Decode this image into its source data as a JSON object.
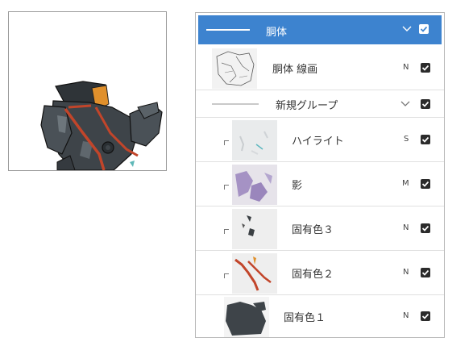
{
  "panel": {
    "group_top": {
      "name": "胴体"
    },
    "layers": [
      {
        "name": "胴体 線画",
        "blend": "N"
      },
      {
        "name": "新規グループ"
      },
      {
        "name": "ハイライト",
        "blend": "S"
      },
      {
        "name": "影",
        "blend": "M"
      },
      {
        "name": "固有色３",
        "blend": "N"
      },
      {
        "name": "固有色２",
        "blend": "N"
      },
      {
        "name": "固有色１",
        "blend": "N"
      }
    ]
  },
  "colors": {
    "selected_row": "#3d83cf",
    "checkbox": "#2b2b2b",
    "armor": "#3e4449",
    "accent_orange": "#e0902c",
    "strap_red": "#c2452a",
    "shadow_purple": "#a592c4"
  },
  "icons": {
    "visibility": "checkbox-icon",
    "group_toggle": "chevron-down-icon",
    "clipping": "clipping-icon"
  }
}
